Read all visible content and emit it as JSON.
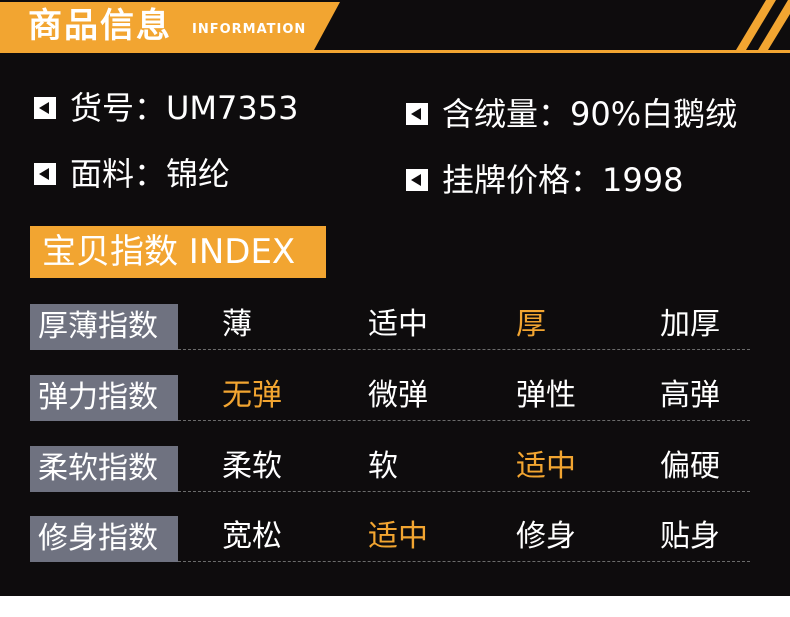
{
  "header": {
    "title": "商品信息",
    "subtitle": "INFORMATION"
  },
  "info": {
    "item_no": "货号：UM7353",
    "fabric": "面料：锦纶",
    "down": "含绒量：90%白鹅绒",
    "price": "挂牌价格：1998"
  },
  "index": {
    "title": "宝贝指数 INDEX",
    "scales": [
      {
        "label": "厚薄指数",
        "options": [
          "薄",
          "适中",
          "厚",
          "加厚"
        ],
        "selected": 2
      },
      {
        "label": "弹力指数",
        "options": [
          "无弹",
          "微弹",
          "弹性",
          "高弹"
        ],
        "selected": 0
      },
      {
        "label": "柔软指数",
        "options": [
          "柔软",
          "软",
          "适中",
          "偏硬"
        ],
        "selected": 2
      },
      {
        "label": "修身指数",
        "options": [
          "宽松",
          "适中",
          "修身",
          "贴身"
        ],
        "selected": 1
      }
    ]
  },
  "colors": {
    "accent": "#f2a531",
    "background": "#0e0c0d",
    "label_bg": "#6f7280",
    "text": "#ffffff"
  }
}
